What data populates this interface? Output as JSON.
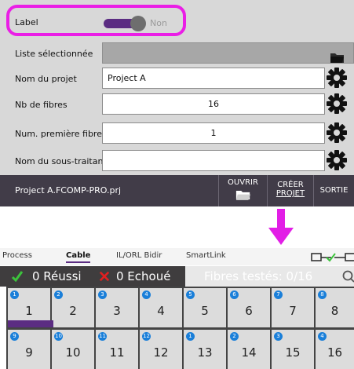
{
  "form": {
    "label_row": {
      "label": "Label",
      "toggle_state": "Non"
    },
    "liste_row": {
      "label": "Liste sélectionnée",
      "value": ""
    },
    "projet_row": {
      "label": "Nom du projet",
      "value": "Project A"
    },
    "fibres_row": {
      "label": "Nb de fibres",
      "value": "16"
    },
    "premiere_row": {
      "label": "Num. première fibre",
      "value": "1"
    },
    "sous_traitant_row": {
      "label": "Nom du sous-traitan",
      "value": ""
    }
  },
  "bottom_bar": {
    "filename": "Project A.FCOMP-PRO.prj",
    "ouvrir_label": "OUVRIR",
    "creer_label_1": "CRÉER",
    "creer_label_2": "PROJET",
    "sortie_label": "SORTIE"
  },
  "tabs": {
    "process": "Process",
    "cable": "Cable",
    "ilorl": "IL/ORL Bidir",
    "smartlink": "SmartLink",
    "active": "Cable"
  },
  "status": {
    "passed": "0 Réussi",
    "failed": "0 Echoué",
    "tested": "Fibres testés: 0/16"
  },
  "fibers": [
    {
      "badge": "1",
      "num": "1"
    },
    {
      "badge": "2",
      "num": "2"
    },
    {
      "badge": "3",
      "num": "3"
    },
    {
      "badge": "4",
      "num": "4"
    },
    {
      "badge": "5",
      "num": "5"
    },
    {
      "badge": "6",
      "num": "6"
    },
    {
      "badge": "7",
      "num": "7"
    },
    {
      "badge": "8",
      "num": "8"
    },
    {
      "badge": "9",
      "num": "9"
    },
    {
      "badge": "10",
      "num": "10"
    },
    {
      "badge": "11",
      "num": "11"
    },
    {
      "badge": "12",
      "num": "12"
    },
    {
      "badge": "1",
      "num": "13"
    },
    {
      "badge": "2",
      "num": "14"
    },
    {
      "badge": "3",
      "num": "15"
    },
    {
      "badge": "4",
      "num": "16"
    }
  ],
  "colors": {
    "accent_purple": "#5b2c82",
    "highlight_magenta": "#ea1ee6",
    "badge_blue": "#1a7fd9",
    "pass_green": "#3cc43c",
    "fail_red": "#e02020"
  }
}
